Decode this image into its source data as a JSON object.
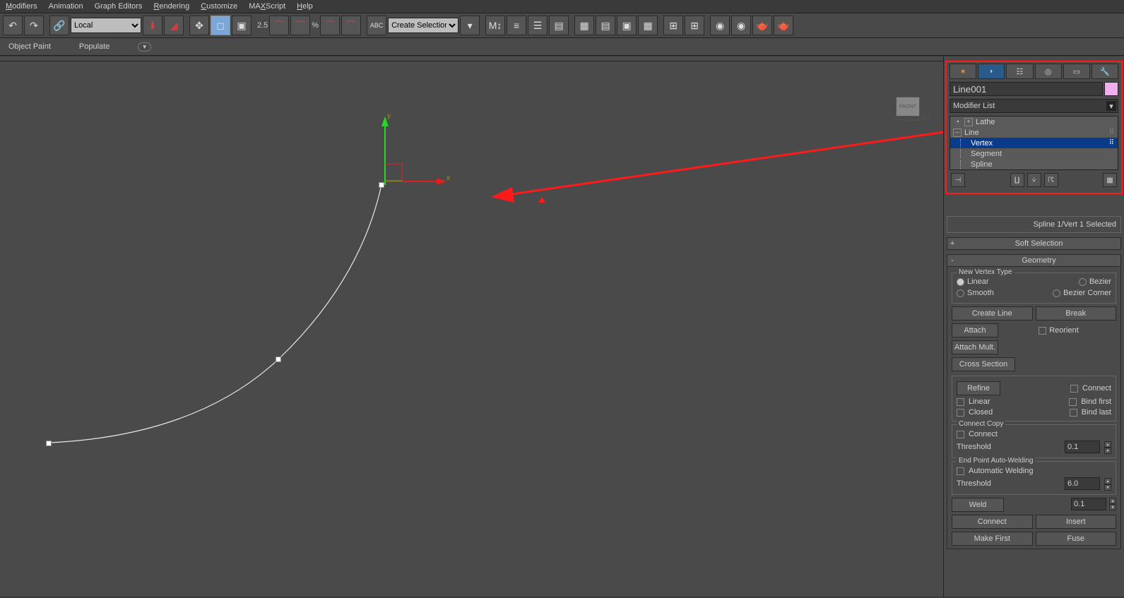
{
  "menu": {
    "modifiers": "Modifiers",
    "animation": "Animation",
    "graph": "Graph Editors",
    "rendering": "Rendering",
    "customize": "Customize",
    "maxscript": "MAXScript",
    "help": "Help"
  },
  "toolbar": {
    "coord_sys": "Local",
    "spinner_val": "2.5",
    "named_sel": "Create Selection Se"
  },
  "ribbon": {
    "object_paint": "Object Paint",
    "populate": "Populate"
  },
  "viewcube": {
    "face": "FRONT"
  },
  "axes": {
    "x": "x",
    "y": "y"
  },
  "panel": {
    "object_name": "Line001",
    "modifier_list": "Modifier List",
    "stack": {
      "lathe": "Lathe",
      "line": "Line",
      "vertex": "Vertex",
      "segment": "Segment",
      "spline": "Spline"
    },
    "selection_info": "Spline 1/Vert 1 Selected",
    "soft_sel_title": "Soft Selection",
    "geom_title": "Geometry",
    "new_vertex_type": "New Vertex Type",
    "vt_linear": "Linear",
    "vt_bezier": "Bezier",
    "vt_smooth": "Smooth",
    "vt_bezcorner": "Bezier Corner",
    "create_line": "Create Line",
    "break": "Break",
    "attach": "Attach",
    "reorient": "Reorient",
    "attach_mult": "Attach Mult.",
    "cross_section": "Cross Section",
    "refine": "Refine",
    "connect": "Connect",
    "linear_chk": "Linear",
    "bind_first": "Bind first",
    "closed": "Closed",
    "bind_last": "Bind last",
    "connect_copy": "Connect Copy",
    "connect2": "Connect",
    "threshold": "Threshold",
    "thresh_val": "0.1",
    "endpoint": "End Point Auto-Welding",
    "auto_weld": "Automatic Welding",
    "thresh2_val": "6.0",
    "weld": "Weld",
    "weld_val": "0.1",
    "connect_btn": "Connect",
    "insert": "Insert",
    "make_first": "Make First",
    "fuse": "Fuse"
  }
}
